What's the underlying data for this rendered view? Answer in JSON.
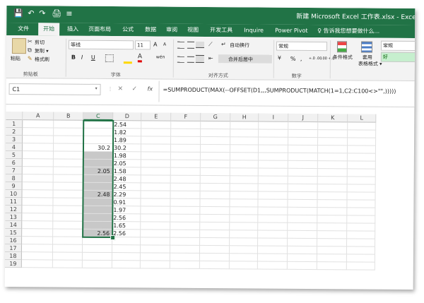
{
  "titlebar": {
    "document_title": "新建 Microsoft Excel 工作表.xlsx - Excel",
    "save_glyph": "💾",
    "undo_glyph": "↶",
    "redo_glyph": "↷",
    "print_preview_glyph": "🖨",
    "customize_glyph": "≡"
  },
  "tabs": [
    "文件",
    "开始",
    "插入",
    "页面布局",
    "公式",
    "数据",
    "审阅",
    "视图",
    "开发工具",
    "Inquire",
    "Power Pivot"
  ],
  "active_tab": "开始",
  "tell_me": "告诉我您想要做什么...",
  "ribbon": {
    "clipboard": {
      "paste": "粘贴",
      "cut": "剪切",
      "copy": "复制 ▾",
      "format_painter": "格式刷",
      "label": "剪贴板"
    },
    "font": {
      "name": "等线",
      "size": "11",
      "bold": "B",
      "italic": "I",
      "underline": "U",
      "grow": "A",
      "shrink": "A",
      "wen": "wén",
      "label": "字体"
    },
    "alignment": {
      "wrap": "自动换行",
      "merge": "合并后居中",
      "label": "对齐方式"
    },
    "number": {
      "format": "常规",
      "percent": "%",
      "comma": ",",
      "inc_dec": "+.0 .00",
      "dec_dec": ".00 +.0",
      "label": "数字"
    },
    "styles": {
      "conditional": "条件格式",
      "table": "套用\n表格格式",
      "normal": "常规",
      "good": "好"
    }
  },
  "formula_bar": {
    "name_box": "C1",
    "fx": "fx",
    "cancel": "✕",
    "enter": "✓",
    "formula": "=SUMPRODUCT(MAX(--OFFSET(D1,,,SUMPRODUCT(MATCH(1=1,C2:C100<>\"\",)))))"
  },
  "grid": {
    "columns": [
      "A",
      "B",
      "C",
      "D",
      "E",
      "F",
      "G",
      "H",
      "I",
      "J",
      "K",
      "L"
    ],
    "selected_column": "C",
    "rows": [
      "1",
      "2",
      "3",
      "4",
      "5",
      "6",
      "7",
      "8",
      "9",
      "10",
      "11",
      "12",
      "13",
      "14",
      "15",
      "16",
      "17",
      "18",
      "19"
    ],
    "c_values": {
      "4": "30.2",
      "7": "2.05",
      "10": "2.48",
      "15": "2.56"
    },
    "d_values": [
      "2.54",
      "1.82",
      "1.89",
      "30.2",
      "1.98",
      "2.05",
      "1.58",
      "2.48",
      "2.45",
      "2.29",
      "0.91",
      "1.97",
      "2.56",
      "1.65",
      "2.56"
    ]
  }
}
